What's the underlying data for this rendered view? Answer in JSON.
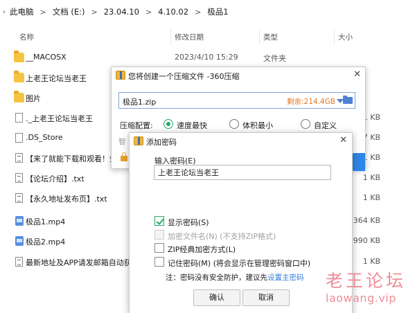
{
  "breadcrumb": {
    "items": [
      "此电脑",
      "文档 (E:)",
      "23.04.10",
      "4.10.02",
      "极品1"
    ],
    "sep": ">",
    "up_arrow": "›"
  },
  "columns": {
    "name": "名称",
    "date": "修改日期",
    "type": "类型",
    "size": "大小"
  },
  "files": [
    {
      "icon": "folder-icon",
      "name": "__MACOSX",
      "date": "2023/4/10 15:29",
      "type": "文件夹",
      "size": ""
    },
    {
      "icon": "folder-icon",
      "name": "上老王论坛当老王",
      "date": "",
      "type": "",
      "size": ""
    },
    {
      "icon": "folder-icon",
      "name": "图片",
      "date": "",
      "type": "",
      "size": ""
    },
    {
      "icon": "file-icon",
      "name": "._上老王论坛当老王",
      "date": "",
      "type": "",
      "size": "1 KB"
    },
    {
      "icon": "file-icon",
      "name": ".DS_Store",
      "date": "",
      "type": "",
      "size": "7 KB"
    },
    {
      "icon": "text-file-icon",
      "name": "【来了就能下载和观看！免",
      "date": "",
      "type": "",
      "size": "1 KB"
    },
    {
      "icon": "text-file-icon",
      "name": "【论坛介绍】.txt",
      "date": "",
      "type": "",
      "size": "1 KB"
    },
    {
      "icon": "text-file-icon",
      "name": "【永久地址发布页】.txt",
      "date": "",
      "type": "",
      "size": "1 KB"
    },
    {
      "icon": "video-file-icon",
      "name": "极品1.mp4",
      "date": "",
      "type": "",
      "size": "364 KB"
    },
    {
      "icon": "video-file-icon",
      "name": "极品2.mp4",
      "date": "",
      "type": "",
      "size": "990 KB"
    },
    {
      "icon": "text-file-icon",
      "name": "最新地址及APP请发邮箱自动获",
      "date": "",
      "type": "",
      "size": "1 KB"
    }
  ],
  "compress_dialog": {
    "title": "您将创建一个压缩文件 -360压缩",
    "close": "✕",
    "path_value": "极品1.zip",
    "free_space": "剩余:214.4GB",
    "level_label": "压缩配置:",
    "levels": [
      "速度最快",
      "体积最小",
      "自定义"
    ],
    "selected_level": "速度最快",
    "smart_label": "智"
  },
  "password_dialog": {
    "title": "添加密码",
    "close": "✕",
    "input_label": "输入密码(E)",
    "password_value": "上老王论坛当老王",
    "options": [
      {
        "label": "显示密码(S)",
        "checked": true,
        "disabled": false
      },
      {
        "label": "加密文件名(N) (不支持ZIP格式)",
        "checked": false,
        "disabled": true
      },
      {
        "label": "ZIP经典加密方式(L)",
        "checked": false,
        "disabled": false
      },
      {
        "label": "记住密码(M) (将会显示在管理密码窗口中)",
        "checked": false,
        "disabled": false
      }
    ],
    "note_prefix": "注：密码没有安全防护，建议先",
    "note_link": "设置主密码",
    "ok_label": "确认",
    "cancel_label": "取消"
  },
  "watermark": {
    "cn": "老王论坛",
    "url": "laowang.vip"
  }
}
